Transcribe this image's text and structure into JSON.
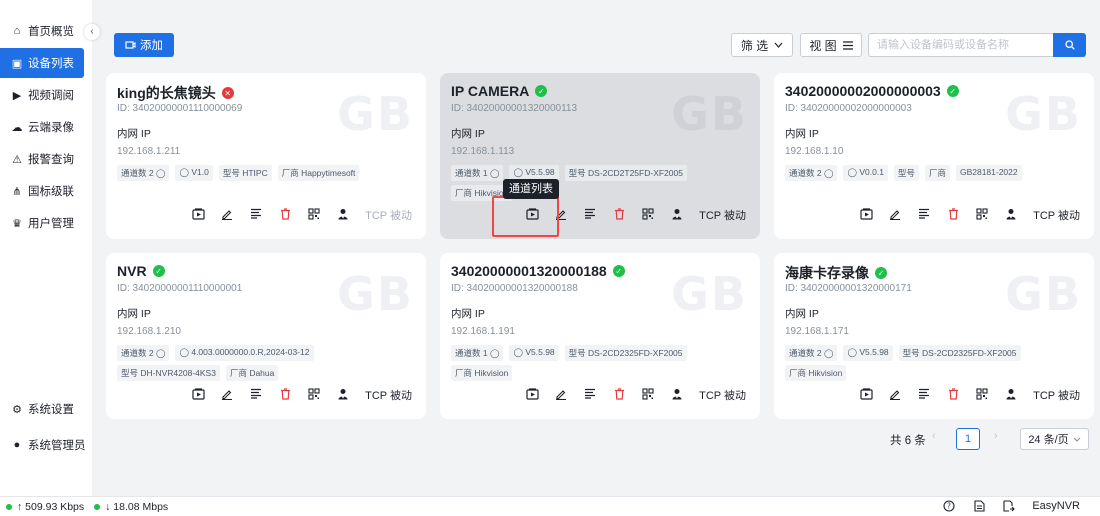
{
  "sidebar": {
    "items": [
      {
        "label": "首页概览",
        "icon": "home-icon",
        "glyph": "⌂"
      },
      {
        "label": "设备列表",
        "icon": "device-icon",
        "glyph": "▣"
      },
      {
        "label": "视频调阅",
        "icon": "play-circle-icon",
        "glyph": "▶"
      },
      {
        "label": "云端录像",
        "icon": "cloud-icon",
        "glyph": "☁"
      },
      {
        "label": "报警查询",
        "icon": "alarm-icon",
        "glyph": "⚠"
      },
      {
        "label": "国标级联",
        "icon": "cascade-icon",
        "glyph": "⋔"
      },
      {
        "label": "用户管理",
        "icon": "user-manage-icon",
        "glyph": "♛"
      }
    ],
    "bottom": [
      {
        "label": "系统设置",
        "icon": "gear-icon",
        "glyph": "⚙"
      },
      {
        "label": "系统管理员",
        "icon": "person-icon",
        "glyph": "●"
      }
    ]
  },
  "toolbar": {
    "add_label": "添加",
    "filter_label": "筛 选",
    "view_label": "视 图",
    "search_placeholder": "请输入设备编码或设备名称"
  },
  "devices": [
    {
      "name": "king的长焦镜头",
      "status": "offline",
      "id": "ID: 34020000001110000069",
      "net_label": "内网 IP",
      "ip": "192.168.1.211",
      "tags": [
        "通道数 2 ◯",
        "◯ V1.0",
        "型号 HTIPC",
        "厂商 Happytimesoft"
      ],
      "mode": "TCP 被动",
      "mode_dim": true
    },
    {
      "name": "IP CAMERA",
      "status": "online",
      "id": "ID: 34020000001320000113",
      "net_label": "内网 IP",
      "ip": "192.168.1.113",
      "tags": [
        "通道数 1 ◯",
        "◯ V5.5.98",
        "型号 DS-2CD2T25FD-XF2005",
        "厂商 Hikvision"
      ],
      "mode": "TCP 被动",
      "mode_dim": false
    },
    {
      "name": "34020000002000000003",
      "status": "online",
      "id": "ID: 34020000002000000003",
      "net_label": "内网 IP",
      "ip": "192.168.1.10",
      "tags": [
        "通道数 2 ◯",
        "◯ V0.0.1",
        "型号",
        "厂商",
        "GB28181-2022"
      ],
      "mode": "TCP 被动",
      "mode_dim": false
    },
    {
      "name": "NVR",
      "status": "online",
      "id": "ID: 34020000001110000001",
      "net_label": "内网 IP",
      "ip": "192.168.1.210",
      "tags": [
        "通道数 2 ◯",
        "◯ 4.003.0000000.0.R,2024-03-12",
        "型号 DH-NVR4208-4KS3",
        "厂商 Dahua"
      ],
      "mode": "TCP 被动",
      "mode_dim": false
    },
    {
      "name": "34020000001320000188",
      "status": "online",
      "id": "ID: 34020000001320000188",
      "net_label": "内网 IP",
      "ip": "192.168.1.191",
      "tags": [
        "通道数 1 ◯",
        "◯ V5.5.98",
        "型号 DS-2CD2325FD-XF2005",
        "厂商 Hikvision"
      ],
      "mode": "TCP 被动",
      "mode_dim": false
    },
    {
      "name": "海康卡存录像",
      "status": "online",
      "id": "ID: 34020000001320000171",
      "net_label": "内网 IP",
      "ip": "192.168.1.171",
      "tags": [
        "通道数 2 ◯",
        "◯ V5.5.98",
        "型号 DS-2CD2325FD-XF2005",
        "厂商 Hikvision"
      ],
      "mode": "TCP 被动",
      "mode_dim": false
    }
  ],
  "tooltip": "通道列表",
  "pagination": {
    "total": "共 6 条",
    "current": "1",
    "page_size": "24 条/页"
  },
  "statusbar": {
    "upload": "↑ 509.93 Kbps",
    "download": "↓ 18.08 Mbps",
    "app_name": "EasyNVR"
  },
  "colors": {
    "accent": "#1f6fe5",
    "online": "#1fbf4a",
    "offline": "#e5393d"
  }
}
